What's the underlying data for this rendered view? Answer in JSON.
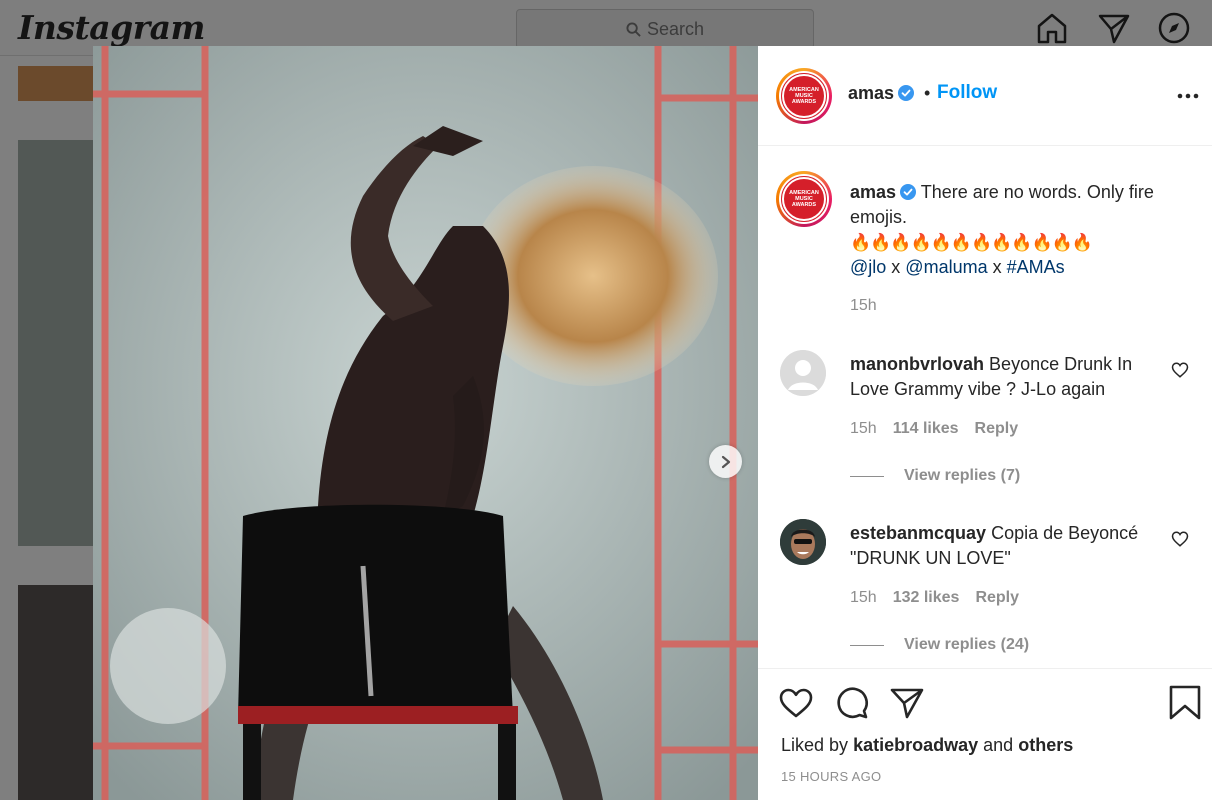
{
  "app": {
    "logo_text": "Instagram",
    "search_placeholder": "Search",
    "nav_icons": [
      "home-icon",
      "direct-icon",
      "explore-icon"
    ]
  },
  "post": {
    "username": "amas",
    "verified": true,
    "header_dot": "•",
    "follow_label": "Follow",
    "avatar_logo_text": "AMERICAN MUSIC AWARDS",
    "caption": {
      "username": "amas",
      "text": "There are no words. Only fire emojis.",
      "emojis": "🔥🔥🔥🔥🔥🔥🔥🔥🔥🔥🔥🔥",
      "mention_1": "@jlo",
      "sep_1": " x ",
      "mention_2": "@maluma",
      "sep_2": " x ",
      "hashtag": "#AMAs",
      "time": "15h"
    },
    "comments": [
      {
        "username": "manonbvrlovah",
        "text": "Beyonce Drunk In Love Grammy vibe ? J-Lo again",
        "time": "15h",
        "likes": "114 likes",
        "reply_label": "Reply",
        "view_replies": "View replies (7)"
      },
      {
        "username": "estebanmcquay",
        "text": "Copia de Beyoncé \"DRUNK UN LOVE\"",
        "time": "15h",
        "likes": "132 likes",
        "reply_label": "Reply",
        "view_replies": "View replies (24)"
      }
    ],
    "liked_by_prefix": "Liked by",
    "liked_by_user": "katiebroadway",
    "liked_by_and": "and",
    "liked_by_others": "others",
    "timestamp": "15 HOURS AGO"
  },
  "colors": {
    "accent": "#0095f6",
    "verified": "#3897f0",
    "muted": "#8e8e8e",
    "brand_red": "#d51f2a"
  }
}
